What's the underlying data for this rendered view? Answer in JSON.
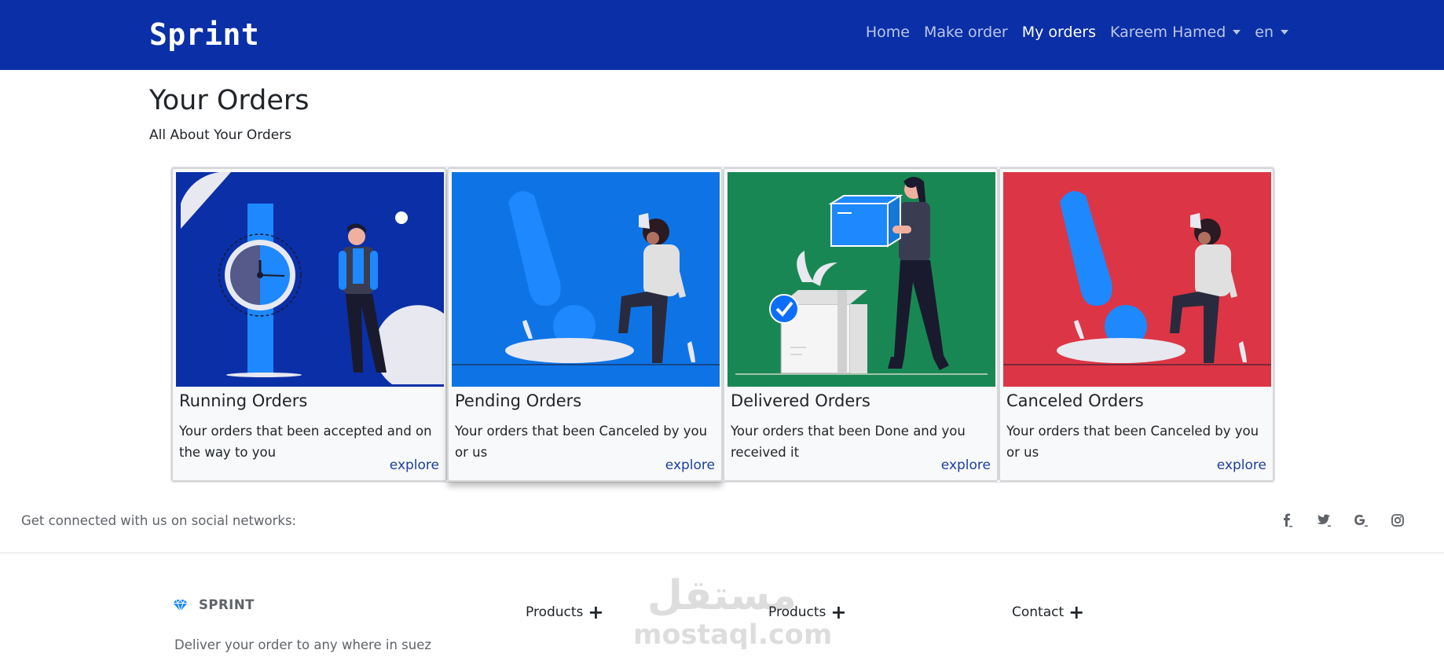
{
  "navbar": {
    "brand": "Sprint",
    "links": [
      {
        "label": "Home"
      },
      {
        "label": "Make order"
      },
      {
        "label": "My orders"
      },
      {
        "label": "Kareem Hamed"
      },
      {
        "label": "en"
      }
    ]
  },
  "page": {
    "title": "Your Orders",
    "subtitle": "All About Your Orders"
  },
  "cards": [
    {
      "title": "Running Orders",
      "text": "Your orders that been accepted and on the way to you",
      "link": "explore",
      "color": "#0a2fa7"
    },
    {
      "title": "Pending Orders",
      "text": "Your orders that been Canceled by you or us",
      "link": "explore",
      "color": "#0e74e6"
    },
    {
      "title": "Delivered Orders",
      "text": "Your orders that been Done and you received it",
      "link": "explore",
      "color": "#198754"
    },
    {
      "title": "Canceled Orders",
      "text": "Your orders that been Canceled by you or us",
      "link": "explore",
      "color": "#dc3545"
    }
  ],
  "social": {
    "text": "Get connected with us on social networks:",
    "icons": [
      "facebook-icon",
      "twitter-icon",
      "google-icon",
      "instagram-icon"
    ]
  },
  "footer": {
    "brand": "SPRINT",
    "description": "Deliver your order to any where in suez",
    "columns": [
      {
        "label": "Products"
      },
      {
        "label": "Products"
      },
      {
        "label": "Contact"
      }
    ]
  },
  "watermark": {
    "top": "مستقل",
    "bottom": "mostaql.com"
  }
}
